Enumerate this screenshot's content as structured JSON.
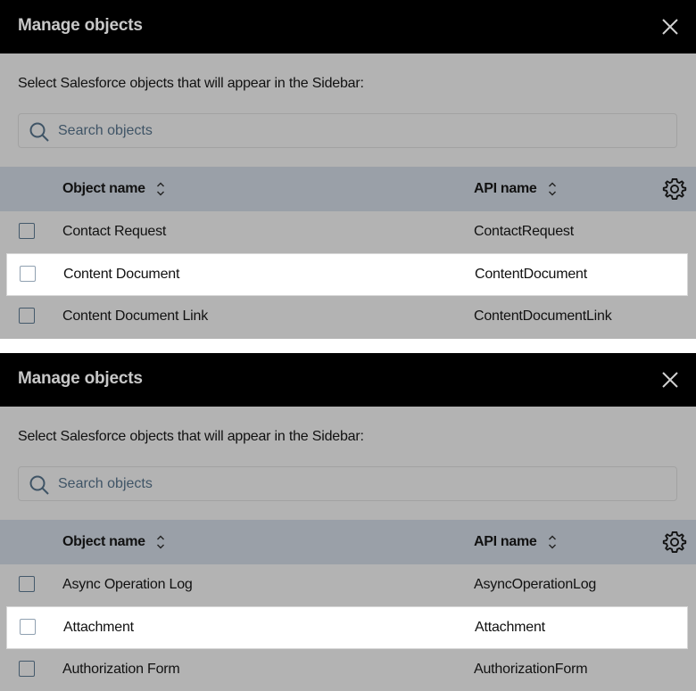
{
  "panels": [
    {
      "title": "Manage objects",
      "description": "Select Salesforce objects that will appear in the Sidebar:",
      "search": {
        "placeholder": "Search objects",
        "value": ""
      },
      "columns": {
        "object_name": "Object name",
        "api_name": "API name"
      },
      "rows": [
        {
          "object_name": "Contact Request",
          "api_name": "ContactRequest",
          "checked": false,
          "highlighted": false
        },
        {
          "object_name": "Content Document",
          "api_name": "ContentDocument",
          "checked": false,
          "highlighted": true
        },
        {
          "object_name": "Content Document Link",
          "api_name": "ContentDocumentLink",
          "checked": false,
          "highlighted": false
        }
      ]
    },
    {
      "title": "Manage objects",
      "description": "Select Salesforce objects that will appear in the Sidebar:",
      "search": {
        "placeholder": "Search objects",
        "value": ""
      },
      "columns": {
        "object_name": "Object name",
        "api_name": "API name"
      },
      "rows": [
        {
          "object_name": "Async Operation Log",
          "api_name": "AsyncOperationLog",
          "checked": false,
          "highlighted": false
        },
        {
          "object_name": "Attachment",
          "api_name": "Attachment",
          "checked": false,
          "highlighted": true
        },
        {
          "object_name": "Authorization Form",
          "api_name": "AuthorizationForm",
          "checked": false,
          "highlighted": false
        }
      ]
    }
  ],
  "icons": {
    "close": "close-icon",
    "search": "search-icon",
    "sort": "sort-icon",
    "settings": "gear-icon"
  },
  "colors": {
    "header_bg": "#000000",
    "body_bg": "#b3b3b3",
    "table_header_bg": "#9aa0a8",
    "highlight_row_bg": "#ffffff"
  }
}
